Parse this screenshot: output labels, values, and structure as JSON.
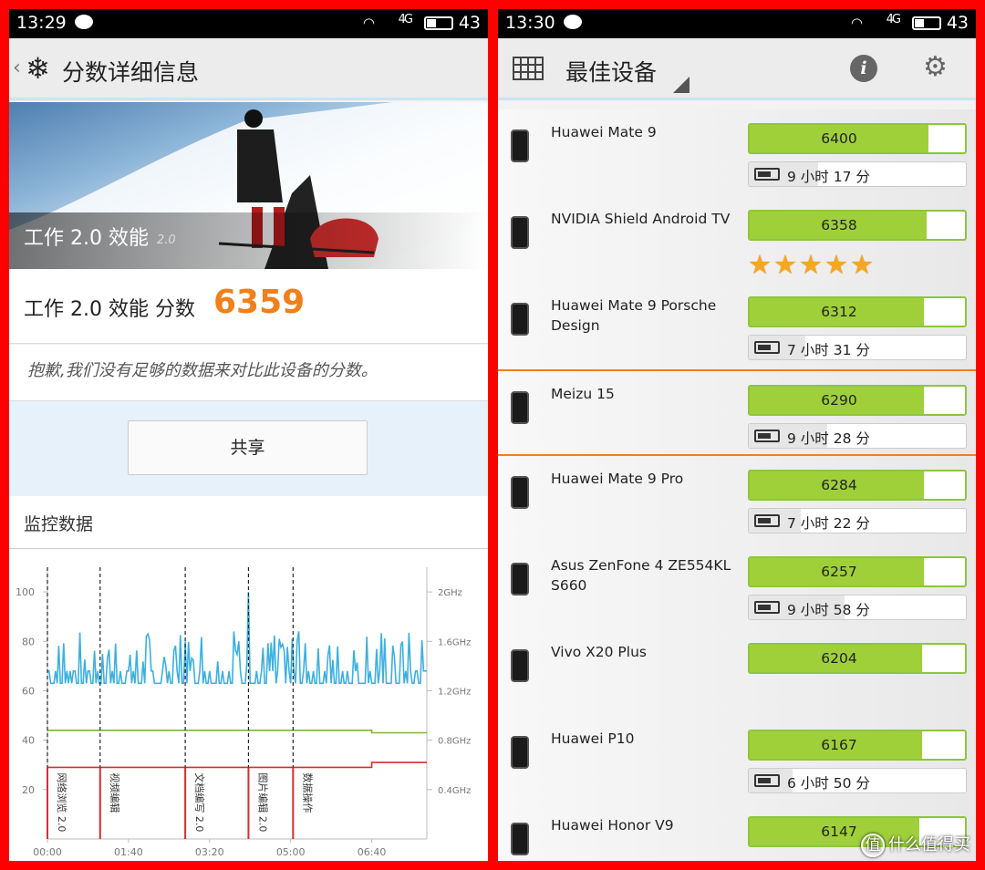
{
  "left": {
    "status": {
      "time": "13:29",
      "signal": "4G",
      "battery": "43"
    },
    "header": {
      "back": "‹",
      "title": "分数详细信息"
    },
    "banner": {
      "title": "工作 2.0 效能",
      "version": "2.0"
    },
    "score": {
      "label": "工作 2.0 效能 分数",
      "value": "6359"
    },
    "message": "抱歉,我们没有足够的数据来对比此设备的分数。",
    "share_label": "共享",
    "monitor_title": "监控数据",
    "chart_data": {
      "type": "line",
      "title": "",
      "xlabel": "",
      "ylabel": "",
      "x_ticks": [
        "00:00",
        "01:40",
        "03:20",
        "05:00",
        "06:40"
      ],
      "y_ticks_left": [
        "20",
        "40",
        "60",
        "80",
        "100"
      ],
      "y_ticks_right": [
        "0.4GHz",
        "0.8GHz",
        "1.2GHz",
        "1.6GHz",
        "2GHz"
      ],
      "ylim_left": [
        0,
        110
      ],
      "xlim_seconds": [
        0,
        468
      ],
      "annotations": [
        {
          "label": "网络浏览 2.0",
          "x": 0
        },
        {
          "label": "视频编辑",
          "x": 65
        },
        {
          "label": "文档编写 2.0",
          "x": 170
        },
        {
          "label": "图片编辑 2.0",
          "x": 248
        },
        {
          "label": "数据操作",
          "x": 303
        }
      ],
      "series": [
        {
          "color": "#3cb0e0"
        },
        {
          "color": "#7cb342"
        },
        {
          "color": "#d32f2f"
        }
      ]
    }
  },
  "right": {
    "status": {
      "time": "13:30",
      "signal": "4G",
      "battery": "43"
    },
    "header": {
      "title": "最佳设备"
    },
    "devices": [
      {
        "name": "Huawei Mate 9",
        "score": "6400",
        "score_fraction": 0.83,
        "battery": "9 小时 17 分",
        "battery_fraction": 0.32
      },
      {
        "name": "NVIDIA Shield Android TV",
        "score": "6358",
        "score_fraction": 0.82,
        "rating": "★★★★★"
      },
      {
        "name": "Huawei Mate 9 Porsche Design",
        "score": "6312",
        "score_fraction": 0.81,
        "battery": "7 小时 31 分",
        "battery_fraction": 0.26
      },
      {
        "name": "Meizu 15",
        "score": "6290",
        "score_fraction": 0.81,
        "battery": "9 小时 28 分",
        "battery_fraction": 0.36,
        "highlight": true
      },
      {
        "name": "Huawei Mate 9 Pro",
        "score": "6284",
        "score_fraction": 0.81,
        "battery": "7 小时 22 分",
        "battery_fraction": 0.24
      },
      {
        "name": "Asus ZenFone 4 ZE554KL S660",
        "score": "6257",
        "score_fraction": 0.81,
        "battery": "9 小时 58 分",
        "battery_fraction": 0.44
      },
      {
        "name": "Vivo X20 Plus",
        "score": "6204",
        "score_fraction": 0.8
      },
      {
        "name": "Huawei P10",
        "score": "6167",
        "score_fraction": 0.8,
        "battery": "6 小时 50 分",
        "battery_fraction": 0.2
      },
      {
        "name": "Huawei Honor V9",
        "score": "6147",
        "score_fraction": 0.79
      }
    ],
    "watermark": "什么值得买",
    "watermark_icon": "值"
  }
}
